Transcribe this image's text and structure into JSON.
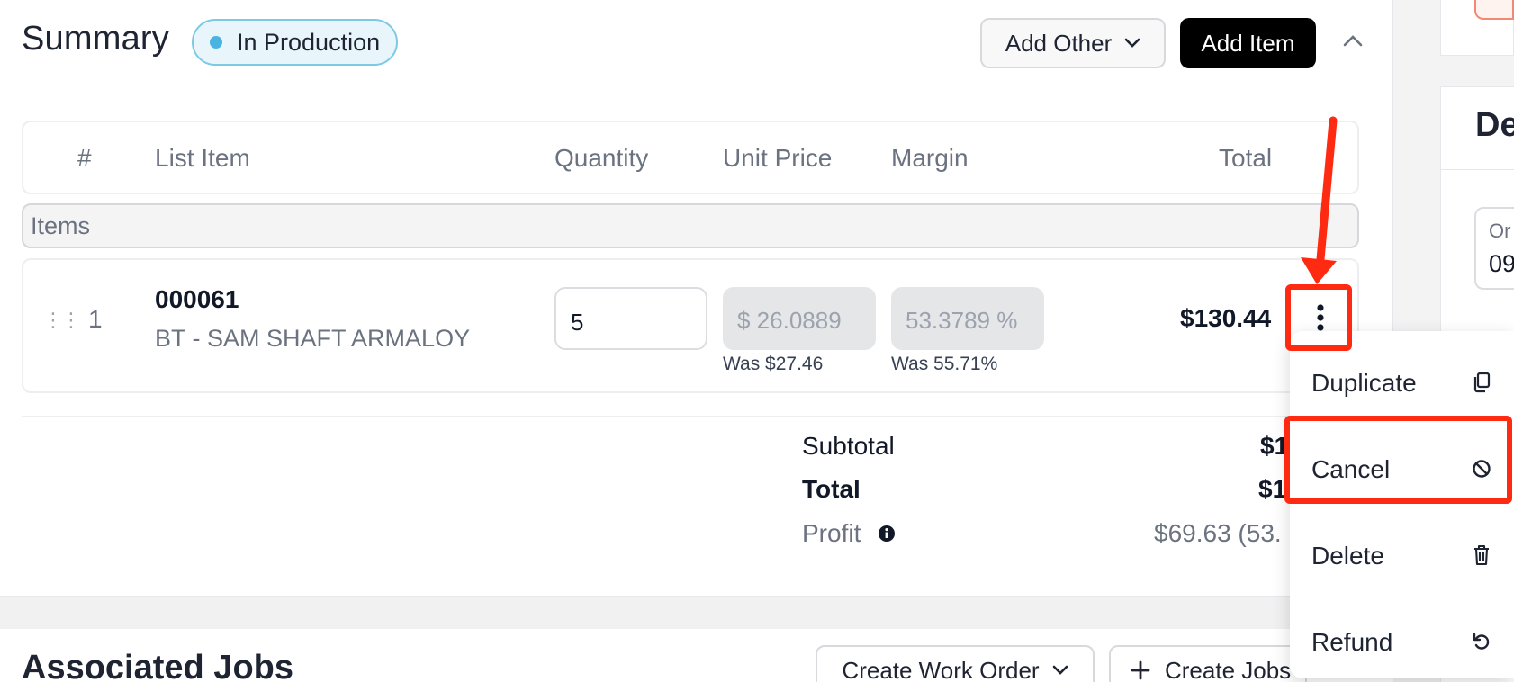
{
  "summary": {
    "title": "Summary",
    "status": "In Production",
    "add_other_label": "Add Other",
    "add_item_label": "Add Item"
  },
  "table": {
    "headers": [
      "#",
      "List Item",
      "Quantity",
      "Unit Price",
      "Margin",
      "Total"
    ],
    "group_label": "Items",
    "rows": [
      {
        "num": "1",
        "code": "000061",
        "description": "BT - SAM SHAFT ARMALOY",
        "quantity": "5",
        "unit_price": "$ 26.0889",
        "was_price": "Was $27.46",
        "margin": "53.3789 %",
        "was_margin": "Was 55.71%",
        "total": "$130.44"
      }
    ]
  },
  "totals": {
    "subtotal_label": "Subtotal",
    "subtotal_value": "$1",
    "total_label": "Total",
    "total_value": "$1",
    "profit_label": "Profit",
    "profit_value": "$69.63 (53."
  },
  "context_menu": {
    "items": [
      {
        "label": "Duplicate",
        "icon": "copy-icon"
      },
      {
        "label": "Cancel",
        "icon": "ban-icon"
      },
      {
        "label": "Delete",
        "icon": "trash-icon"
      },
      {
        "label": "Refund",
        "icon": "undo-icon"
      }
    ]
  },
  "jobs": {
    "title": "Associated Jobs",
    "create_work_order_label": "Create Work Order",
    "create_jobs_label": "Create Jobs"
  },
  "side_panel": {
    "heading": "De",
    "field_label": "Or",
    "field_value": "09"
  },
  "colors": {
    "badge_bg": "#e8f6fc",
    "badge_border": "#7cc9e4",
    "badge_dot": "#4ab3e2",
    "primary_button": "#000000",
    "annotation_red": "#ff2a12"
  }
}
